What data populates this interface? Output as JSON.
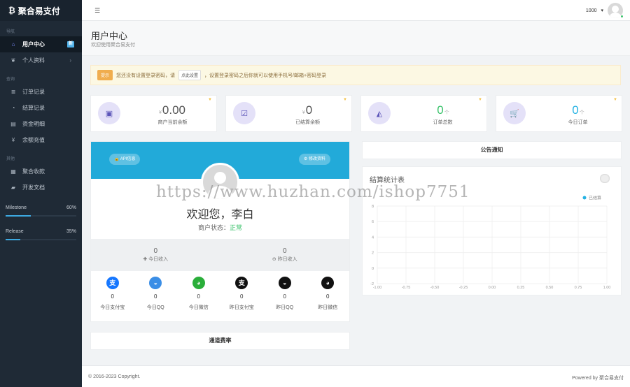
{
  "brand": {
    "logo": "₿",
    "name": "聚合易支付"
  },
  "sidebar": {
    "sections": [
      {
        "title": "导航",
        "items": [
          {
            "label": "用户中心",
            "icon": "home-icon",
            "glyph": "⌂",
            "active": true,
            "badge": "新"
          },
          {
            "label": "个人资料",
            "icon": "leaf-icon",
            "glyph": "❦",
            "chevron": "›"
          }
        ]
      },
      {
        "title": "查询",
        "items": [
          {
            "label": "订单记录",
            "icon": "list-icon",
            "glyph": "≣"
          },
          {
            "label": "结算记录",
            "icon": "pie-icon",
            "glyph": "◔"
          },
          {
            "label": "资金明细",
            "icon": "table-icon",
            "glyph": "▤"
          },
          {
            "label": "余额充值",
            "icon": "yen-icon",
            "glyph": "¥"
          }
        ]
      },
      {
        "title": "其他",
        "items": [
          {
            "label": "聚合收款",
            "icon": "qrcode-icon",
            "glyph": "▦"
          },
          {
            "label": "开发文档",
            "icon": "book-icon",
            "glyph": "▰"
          }
        ]
      }
    ],
    "progress": [
      {
        "label": "Milestone",
        "percent": "60%",
        "value": 0.6
      },
      {
        "label": "Release",
        "percent": "35%",
        "value": 0.35
      }
    ]
  },
  "topbar": {
    "menu_icon": "☰",
    "user_id": "1000",
    "caret": "▾"
  },
  "header": {
    "title": "用户中心",
    "subtitle": "欢迎使用聚合易支付"
  },
  "notice": {
    "tag": "提示",
    "text_before": "您还没有设置登录密码，请",
    "button": "点此设置",
    "text_after": "，设置登录密码之后你就可以使用手机号/邮箱+密码登录"
  },
  "stats": [
    {
      "prefix": "¥",
      "value": "0.00",
      "suffix": "",
      "label": "商户当前余额",
      "icon": "money-icon",
      "glyph": "▣",
      "color": "default"
    },
    {
      "prefix": "¥",
      "value": "0",
      "suffix": "",
      "label": "已结算余额",
      "icon": "checkbox-icon",
      "glyph": "☑",
      "color": "default"
    },
    {
      "prefix": "",
      "value": "0",
      "suffix": "个",
      "label": "订单总数",
      "icon": "area-chart-icon",
      "glyph": "◭",
      "color": "green"
    },
    {
      "prefix": "",
      "value": "0",
      "suffix": "个",
      "label": "今日订单",
      "icon": "cart-icon",
      "glyph": "🛒",
      "color": "blue"
    }
  ],
  "profile": {
    "api_button": "🔒 API信息",
    "edit_button": "⚙ 修改资料",
    "welcome": "欢迎您，李白",
    "status_label": "商户状态：",
    "status_value": "正常",
    "income_today": {
      "value": "0",
      "label": "✚ 今日收入"
    },
    "income_yesterday": {
      "value": "0",
      "label": "⊖ 昨日收入"
    },
    "payments": [
      {
        "label": "今日支付宝",
        "value": "0",
        "glyph": "支",
        "color": "#1677ff",
        "icon": "alipay-icon"
      },
      {
        "label": "今日QQ",
        "value": "0",
        "glyph": "◒",
        "color": "#3a8ee6",
        "icon": "qq-icon"
      },
      {
        "label": "今日微信",
        "value": "0",
        "glyph": "◕",
        "color": "#2aae3a",
        "icon": "wechat-icon"
      },
      {
        "label": "昨日支付宝",
        "value": "0",
        "glyph": "支",
        "color": "#111111",
        "icon": "alipay-icon"
      },
      {
        "label": "昨日QQ",
        "value": "0",
        "glyph": "◒",
        "color": "#111111",
        "icon": "qq-icon"
      },
      {
        "label": "昨日微信",
        "value": "0",
        "glyph": "◕",
        "color": "#111111",
        "icon": "wechat-icon"
      }
    ]
  },
  "rates_title": "通道费率",
  "announcement_title": "公告通知",
  "chart_title": "结算统计表",
  "chart_data": {
    "type": "line",
    "title": "结算统计表",
    "legend": [
      "已结算"
    ],
    "legend_position": "top-right",
    "xticks": [
      "-1.00",
      "-0.75",
      "-0.50",
      "-0.25",
      "0.00",
      "0.25",
      "0.50",
      "0.75",
      "1.00"
    ],
    "yticks": [
      "8",
      "6",
      "4",
      "2",
      "0",
      "-2"
    ],
    "xlim": [
      -1,
      1
    ],
    "ylim": [
      -2,
      8
    ],
    "series": [
      {
        "name": "已结算",
        "values": []
      }
    ],
    "grid": true
  },
  "footer": {
    "copyright": "© 2016-2023 Copyright.",
    "powered_by": "Powered by 聚合易支付"
  },
  "watermark": "https://www.huzhan.com/ishop7751",
  "colors": {
    "accent": "#22aad9",
    "sidebar": "#1f2a36",
    "green": "#39c26a"
  }
}
